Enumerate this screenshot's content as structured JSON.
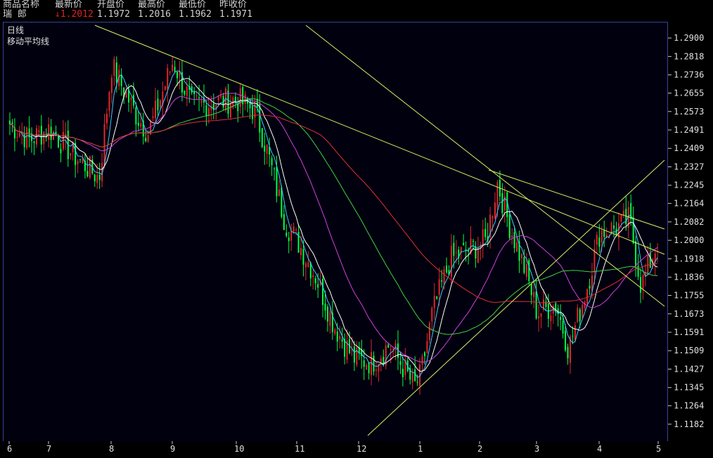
{
  "quote_header": {
    "col_name": "商品名称",
    "col_latest": "最新价",
    "col_open": "开盘价",
    "col_high": "最高价",
    "col_low": "最低价",
    "col_prev": "昨收价",
    "name": "瑞  郎",
    "latest": "↓1.2012",
    "open": "1.1972",
    "high": "1.2016",
    "low": "1.1962",
    "prev": "1.1971"
  },
  "panel": {
    "period_label": "日线",
    "indicator_label": "移动平均线"
  },
  "colors": {
    "up_candle": "#e02828",
    "down_candle": "#00ff44",
    "frame": "#3a3fa0",
    "trendline": "#d8f060",
    "ma_white": "#ffffff",
    "ma_cyan": "#40c8ff",
    "ma_magenta": "#d040e0",
    "ma_green": "#40d040",
    "ma_red": "#e03030"
  },
  "chart_data": {
    "type": "candlestick",
    "y_axis_ticks": [
      "1.2900",
      "1.2818",
      "1.2736",
      "1.2655",
      "1.2573",
      "1.2491",
      "1.2409",
      "1.2327",
      "1.2245",
      "1.2164",
      "1.2082",
      "1.2000",
      "1.1918",
      "1.1836",
      "1.1755",
      "1.1673",
      "1.1591",
      "1.1509",
      "1.1427",
      "1.1345",
      "1.1264",
      "1.1182"
    ],
    "ylim": [
      1.1141,
      1.2941
    ],
    "x_axis_ticks": [
      "6",
      "7",
      "8",
      "9",
      "10",
      "11",
      "12",
      "1",
      "2",
      "3",
      "4",
      "5"
    ],
    "anchor_closes": [
      {
        "month": "6",
        "value": 1.252
      },
      {
        "month": "6.5",
        "value": 1.245
      },
      {
        "month": "7",
        "value": 1.25
      },
      {
        "month": "7.4",
        "value": 1.238
      },
      {
        "month": "7.8",
        "value": 1.228
      },
      {
        "month": "8",
        "value": 1.278
      },
      {
        "month": "8.4",
        "value": 1.256
      },
      {
        "month": "8.6",
        "value": 1.248
      },
      {
        "month": "9",
        "value": 1.28
      },
      {
        "month": "9.3",
        "value": 1.26
      },
      {
        "month": "9.7",
        "value": 1.262
      },
      {
        "month": "10",
        "value": 1.263
      },
      {
        "month": "10.3",
        "value": 1.258
      },
      {
        "month": "10.5",
        "value": 1.24
      },
      {
        "month": "10.8",
        "value": 1.208
      },
      {
        "month": "11",
        "value": 1.2
      },
      {
        "month": "11.3",
        "value": 1.184
      },
      {
        "month": "11.6",
        "value": 1.162
      },
      {
        "month": "11.9",
        "value": 1.148
      },
      {
        "month": "12.2",
        "value": 1.146
      },
      {
        "month": "12.5",
        "value": 1.154
      },
      {
        "month": "12.9",
        "value": 1.135
      },
      {
        "month": "1",
        "value": 1.14
      },
      {
        "month": "1.2",
        "value": 1.168
      },
      {
        "month": "1.5",
        "value": 1.192
      },
      {
        "month": "1.8",
        "value": 1.196
      },
      {
        "month": "2.1",
        "value": 1.2
      },
      {
        "month": "2.3",
        "value": 1.226
      },
      {
        "month": "2.5",
        "value": 1.208
      },
      {
        "month": "2.8",
        "value": 1.186
      },
      {
        "month": "3",
        "value": 1.168
      },
      {
        "month": "3.3",
        "value": 1.172
      },
      {
        "month": "3.5",
        "value": 1.152
      },
      {
        "month": "3.8",
        "value": 1.18
      },
      {
        "month": "4",
        "value": 1.204
      },
      {
        "month": "4.3",
        "value": 1.206
      },
      {
        "month": "4.5",
        "value": 1.21
      },
      {
        "month": "4.7",
        "value": 1.18
      },
      {
        "month": "5",
        "value": 1.201
      }
    ]
  }
}
